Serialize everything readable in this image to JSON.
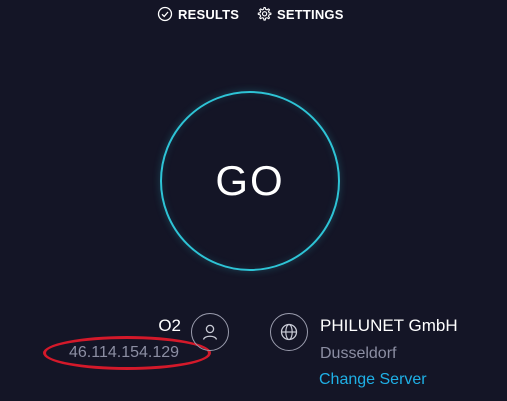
{
  "nav": {
    "results_label": "RESULTS",
    "settings_label": "SETTINGS"
  },
  "go": {
    "label": "GO"
  },
  "isp": {
    "name": "O2",
    "ip": "46.114.154.129",
    "icon": "user-icon"
  },
  "server": {
    "name": "PHILUNET GmbH",
    "city": "Dusseldorf",
    "change_label": "Change Server",
    "icon": "globe-icon"
  },
  "colors": {
    "background": "#141526",
    "ring": "#2ec4d6",
    "link": "#1fb0e6",
    "muted_text": "#8c8ea3",
    "annotation_red": "#d4192a"
  }
}
